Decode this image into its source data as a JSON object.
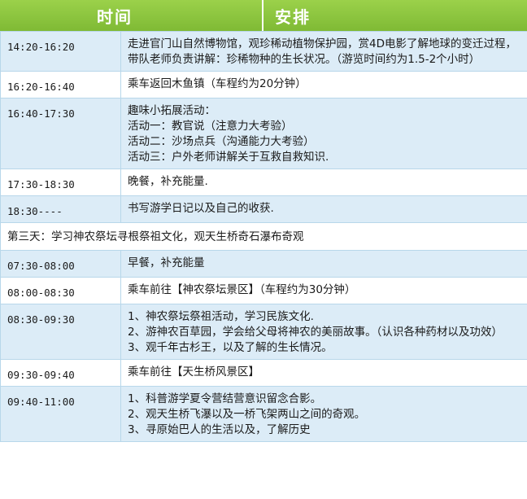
{
  "header": {
    "time": "时间",
    "plan": "安排"
  },
  "rows": [
    {
      "time": "14:20-16:20",
      "lines": [
        "走进官门山自然博物馆，观珍稀动植物保护园，赏4D电影了解地球的变迁过程，带队老师负责讲解：珍稀物种的生长状况。（游览时间约为1.5-2个小时）"
      ]
    },
    {
      "time": "16:20-16:40",
      "lines": [
        "乘车返回木鱼镇（车程约为20分钟）"
      ]
    },
    {
      "time": "16:40-17:30",
      "lines": [
        "趣味小拓展活动：",
        "活动一：教官说（注意力大考验）",
        "活动二：沙场点兵（沟通能力大考验）",
        "活动三：户外老师讲解关于互救自救知识."
      ]
    },
    {
      "time": "17:30-18:30",
      "lines": [
        "晚餐，补充能量."
      ]
    },
    {
      "time": "18:30----",
      "lines": [
        "书写游学日记以及自己的收获."
      ]
    }
  ],
  "day3": {
    "title": "第三天：学习神农祭坛寻根祭祖文化，观天生桥奇石瀑布奇观"
  },
  "rows2": [
    {
      "time": "07:30-08:00",
      "lines": [
        "早餐，补充能量"
      ]
    },
    {
      "time": "08:00-08:30",
      "lines": [
        "乘车前往【神农祭坛景区】（车程约为30分钟）"
      ]
    },
    {
      "time": "08:30-09:30",
      "lines": [
        "1、神农祭坛祭祖活动，学习民族文化.",
        "2、游神农百草园，学会给父母将神农的美丽故事。（认识各种药材以及功效）",
        "3、观千年古杉王，以及了解的生长情况。"
      ]
    },
    {
      "time": "09:30-09:40",
      "lines": [
        "乘车前往【天生桥风景区】"
      ]
    },
    {
      "time": "09:40-11:00",
      "lines": [
        "1、科普游学夏令营结营意识留念合影。",
        "2、观天生桥飞瀑以及一桥飞架两山之间的奇观。",
        "3、寻原始巴人的生活以及，了解历史"
      ]
    }
  ]
}
